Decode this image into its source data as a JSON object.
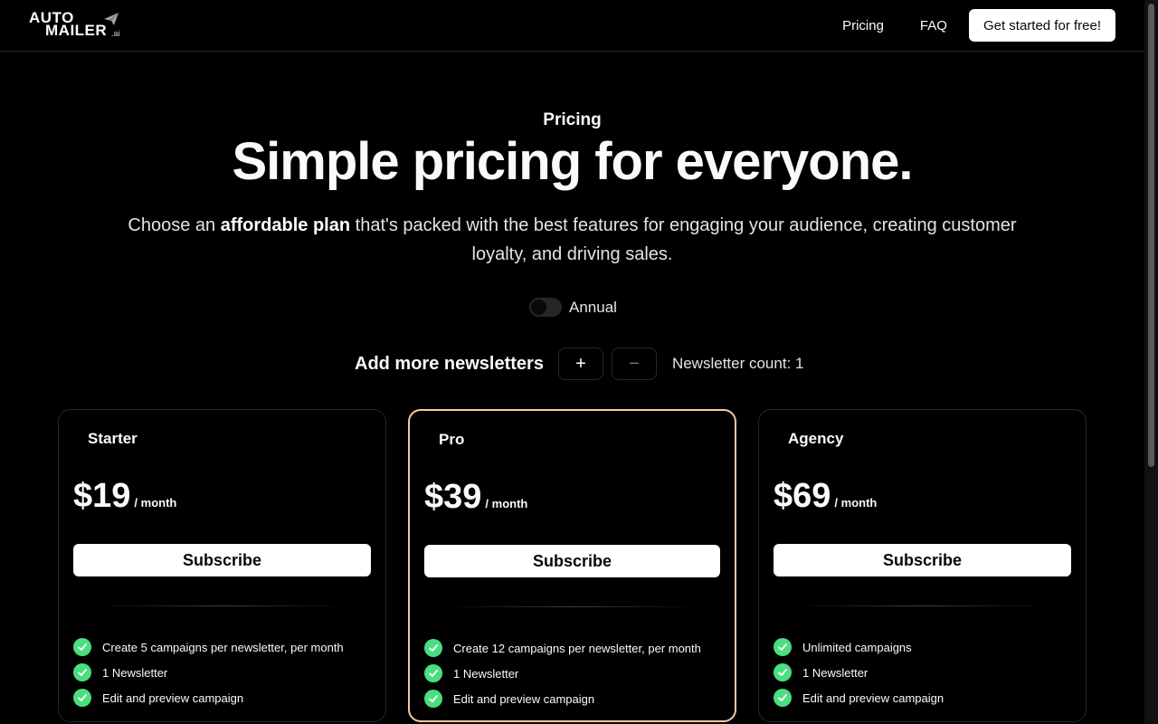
{
  "header": {
    "logo_line1": "AUTO",
    "logo_line2": "MAILER",
    "logo_suffix": ".ai",
    "nav": [
      "Pricing",
      "FAQ"
    ],
    "cta": "Get started for free!"
  },
  "hero": {
    "eyebrow": "Pricing",
    "title": "Simple pricing for everyone.",
    "subtitle_pre": "Choose an ",
    "subtitle_bold": "affordable plan",
    "subtitle_post": " that's packed with the best features for engaging your audience, creating customer loyalty, and driving sales."
  },
  "billing": {
    "label": "Annual",
    "annual_on": false
  },
  "newsletters": {
    "title": "Add more newsletters",
    "plus": "+",
    "minus": "−",
    "count_label": "Newsletter count: 1"
  },
  "plans": [
    {
      "name": "Starter",
      "price": "$19",
      "period": "/ month",
      "button": "Subscribe",
      "features": [
        "Create 5 campaigns per newsletter, per month",
        "1 Newsletter",
        "Edit and preview campaign"
      ]
    },
    {
      "name": "Pro",
      "price": "$39",
      "period": "/ month",
      "button": "Subscribe",
      "highlighted": true,
      "features": [
        "Create 12 campaigns per newsletter, per month",
        "1 Newsletter",
        "Edit and preview campaign"
      ]
    },
    {
      "name": "Agency",
      "price": "$69",
      "period": "/ month",
      "button": "Subscribe",
      "features": [
        "Unlimited campaigns",
        "1 Newsletter",
        "Edit and preview campaign"
      ]
    }
  ],
  "colors": {
    "accent_border": "#f6c9a0",
    "check": "#4ade80",
    "background": "#000000"
  }
}
